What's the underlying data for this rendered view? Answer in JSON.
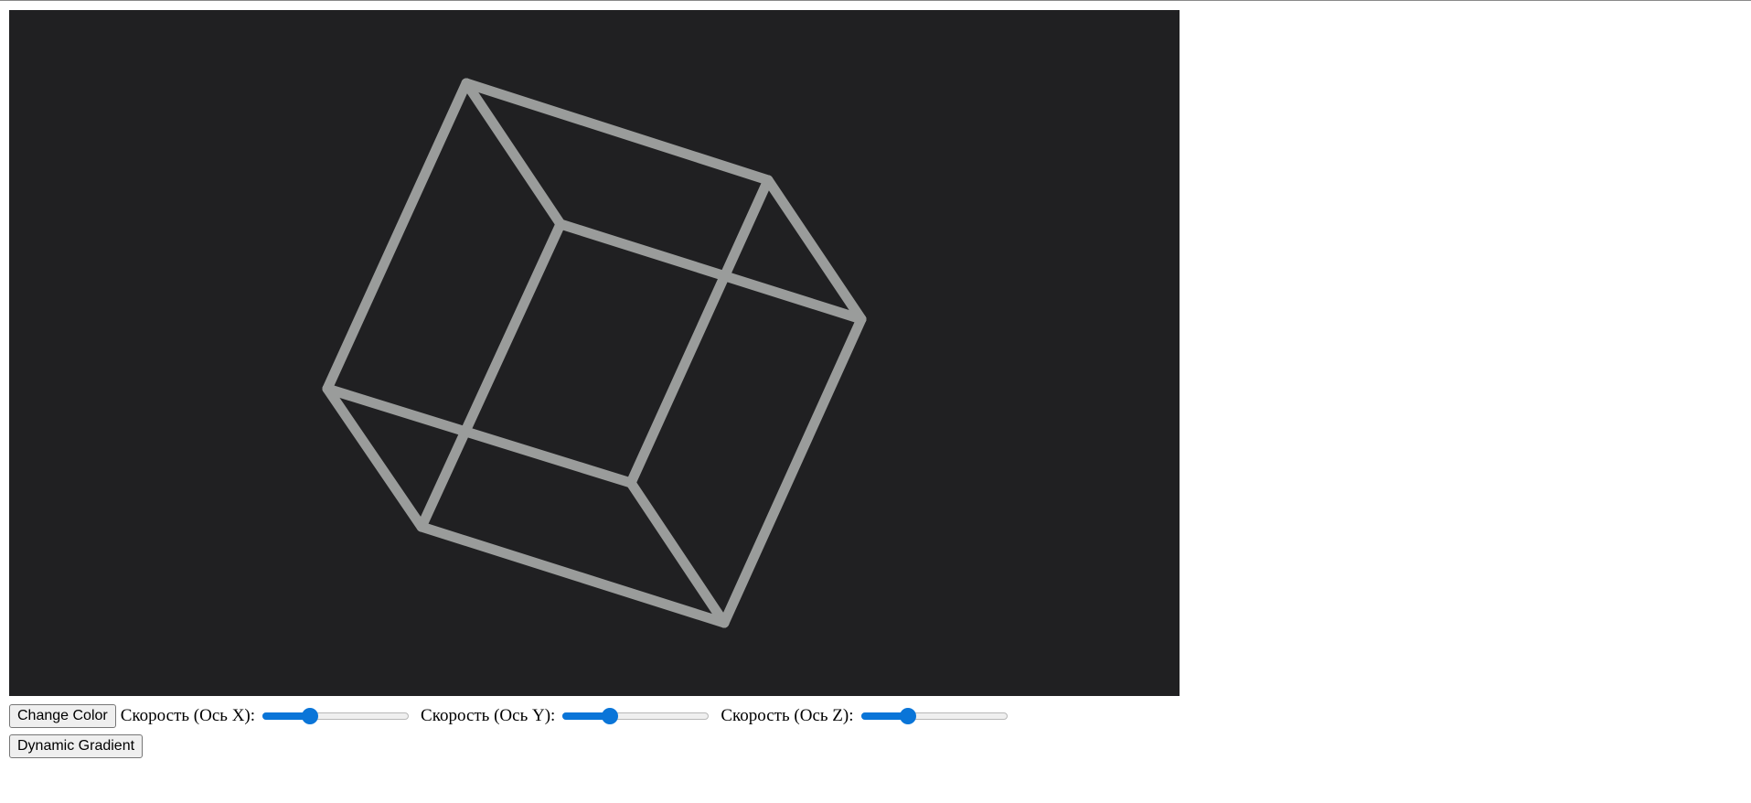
{
  "controls": {
    "change_color_label": "Change Color",
    "dynamic_gradient_label": "Dynamic Gradient",
    "sliders": [
      {
        "label": "Скорость (Ось X):",
        "value_fraction": 0.3
      },
      {
        "label": "Скорость (Ось Y):",
        "value_fraction": 0.3
      },
      {
        "label": "Скорость (Ось Z):",
        "value_fraction": 0.3
      }
    ]
  },
  "scene": {
    "background_color": "#202022",
    "cube_color": "#9a9c9b",
    "shape": "wireframe-cube"
  },
  "colors": {
    "accent": "#0a75d8"
  }
}
